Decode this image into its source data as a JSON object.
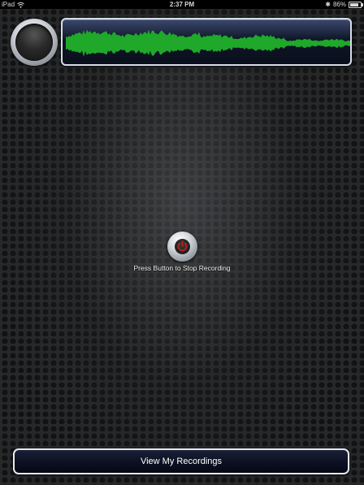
{
  "status_bar": {
    "device": "iPad",
    "time": "2:37 PM",
    "battery_percent": "86%",
    "battery_level": 0.86,
    "icons": [
      "wifi-icon",
      "bluetooth-icon",
      "battery-icon"
    ]
  },
  "recorder": {
    "stop_label": "Press Button to Stop Recording",
    "view_recordings_label": "View My Recordings",
    "waveform_color": "#1fa82a",
    "power_icon_color": "#c0201a"
  }
}
